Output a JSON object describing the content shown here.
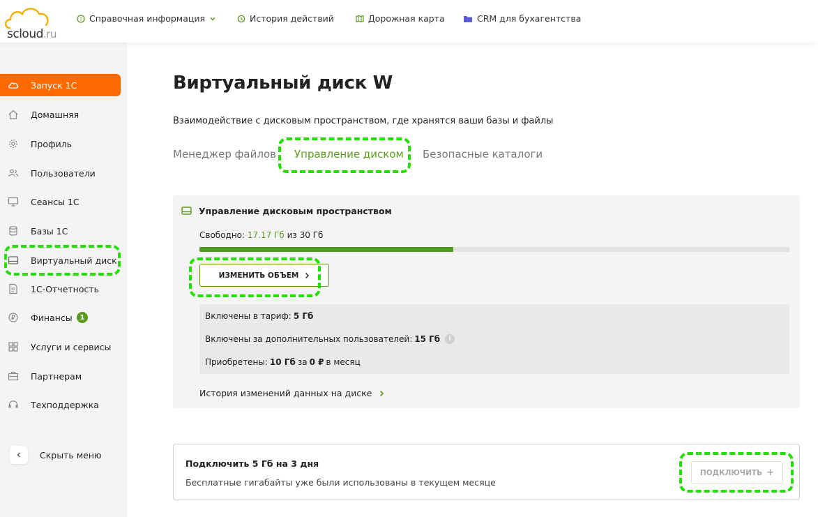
{
  "logo": {
    "name": "scloud",
    "suffix": ".ru"
  },
  "header_nav": [
    {
      "label": "Справочная информация",
      "icon": "help-circle-icon"
    },
    {
      "label": "История действий",
      "icon": "history-clock-icon"
    },
    {
      "label": "Дорожная карта",
      "icon": "map-icon"
    },
    {
      "label": "CRM для бухагентства",
      "icon": "folder-icon"
    }
  ],
  "sidebar": {
    "items": [
      {
        "label": "Запуск 1С",
        "icon": "cloud-icon",
        "active": true
      },
      {
        "label": "Домашняя",
        "icon": "home-icon"
      },
      {
        "label": "Профиль",
        "icon": "gear-icon"
      },
      {
        "label": "Пользователи",
        "icon": "users-icon"
      },
      {
        "label": "Сеансы 1С",
        "icon": "monitor-icon"
      },
      {
        "label": "Базы 1С",
        "icon": "database-icon"
      },
      {
        "label": "Виртуальный диск",
        "icon": "drive-icon"
      },
      {
        "label": "1С-Отчетность",
        "icon": "document-icon"
      },
      {
        "label": "Финансы",
        "icon": "ruble-icon",
        "badge": "1"
      },
      {
        "label": "Услуги и сервисы",
        "icon": "grid-icon"
      },
      {
        "label": "Партнерам",
        "icon": "briefcase-icon"
      },
      {
        "label": "Техподдержка",
        "icon": "headset-icon"
      }
    ],
    "hide_label": "Скрыть меню"
  },
  "page": {
    "title": "Виртуальный диск W",
    "subtitle": "Взаимодействие с дисковым пространством, где хранятся ваши базы и файлы",
    "tabs": [
      {
        "label": "Менеджер файлов"
      },
      {
        "label": "Управление диском",
        "active": true
      },
      {
        "label": "Безопасные каталоги"
      }
    ]
  },
  "disk": {
    "title": "Управление дисковым пространством",
    "free_label": "Свободно:",
    "free_value": "17.17 Гб",
    "free_of": "из 30 Гб",
    "used_fraction": 0.43,
    "change_button": "ИЗМЕНИТЬ ОБЪЕМ",
    "included_label": "Включены в тариф:",
    "included_value": "5 Гб",
    "extra_users_label": "Включены за дополнительных пользователей:",
    "extra_users_value": "15 Гб",
    "purchased_label": "Приобретены:",
    "purchased_value": "10 Гб",
    "purchased_for": "за",
    "purchased_price": "0 ₽",
    "purchased_period": "в месяц",
    "history_link": "История изменений данных на диске"
  },
  "promo": {
    "title": "Подключить 5 Гб на 3 дня",
    "text": "Бесплатные гигабайты уже были использованы в текущем месяце",
    "button": "ПОДКЛЮЧИТЬ"
  },
  "colors": {
    "accent_orange": "#ff6a00",
    "accent_green": "#5a9c1e",
    "highlight": "#22e000"
  }
}
